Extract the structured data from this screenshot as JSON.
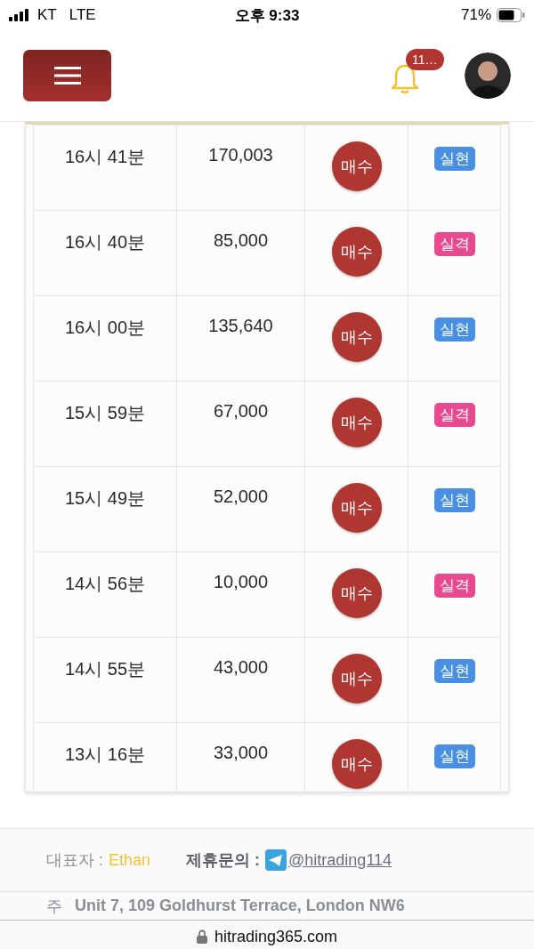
{
  "status_bar": {
    "carrier": "KT",
    "network": "LTE",
    "time": "오후 9:33",
    "battery": "71%"
  },
  "header": {
    "notification_count": "11…"
  },
  "table": {
    "rows": [
      {
        "time": "16시 41분",
        "amount": "170,003",
        "action": "매수",
        "result": {
          "label": "실현",
          "kind": "realized"
        }
      },
      {
        "time": "16시 40분",
        "amount": "85,000",
        "action": "매수",
        "result": {
          "label": "실격",
          "kind": "disqualified"
        }
      },
      {
        "time": "16시 00분",
        "amount": "135,640",
        "action": "매수",
        "result": {
          "label": "실현",
          "kind": "realized"
        }
      },
      {
        "time": "15시 59분",
        "amount": "67,000",
        "action": "매수",
        "result": {
          "label": "실격",
          "kind": "disqualified"
        }
      },
      {
        "time": "15시 49분",
        "amount": "52,000",
        "action": "매수",
        "result": {
          "label": "실현",
          "kind": "realized"
        }
      },
      {
        "time": "14시 56분",
        "amount": "10,000",
        "action": "매수",
        "result": {
          "label": "실격",
          "kind": "disqualified"
        }
      },
      {
        "time": "14시 55분",
        "amount": "43,000",
        "action": "매수",
        "result": {
          "label": "실현",
          "kind": "realized"
        }
      },
      {
        "time": "13시 16분",
        "amount": "33,000",
        "action": "매수",
        "result": {
          "label": "실현",
          "kind": "realized"
        }
      }
    ]
  },
  "footer": {
    "ceo_label": "대표자 :",
    "ceo_name": "Ethan",
    "contact_label": "제휴문의 :",
    "contact_link": "@hitrading114",
    "address_label": "주",
    "address": "Unit 7, 109 Goldhurst Terrace, London NW6"
  },
  "browser": {
    "url": "hitrading365.com"
  }
}
